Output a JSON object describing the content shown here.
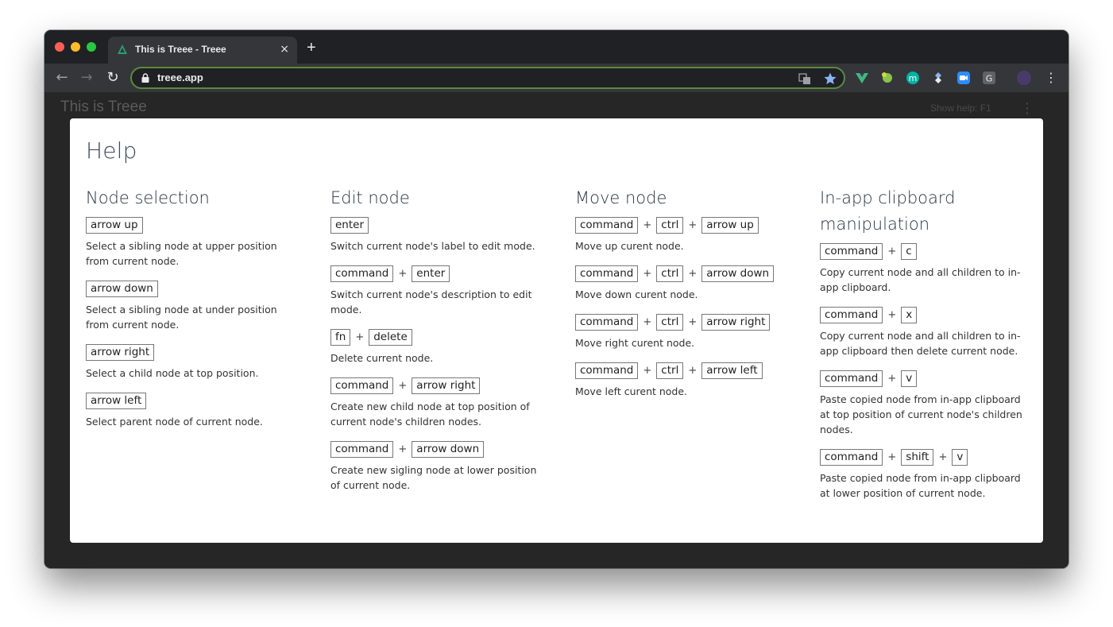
{
  "browser": {
    "tab_title": "This is Treee - Treee",
    "tab_close_icon": "×",
    "new_tab_icon": "+",
    "url": "treee.app",
    "accent": "#5b8a3c"
  },
  "app": {
    "title": "This is Treee",
    "help_hint": "Show help: F1",
    "menu_icon": "⋮"
  },
  "help": {
    "title": "Help",
    "columns": [
      {
        "heading": "Node selection",
        "entries": [
          {
            "keys": [
              "arrow up"
            ],
            "desc": "Select a sibling node at upper position from current node."
          },
          {
            "keys": [
              "arrow down"
            ],
            "desc": "Select a sibling node at under position from current node."
          },
          {
            "keys": [
              "arrow right"
            ],
            "desc": "Select a child node at top position."
          },
          {
            "keys": [
              "arrow left"
            ],
            "desc": "Select parent node of current node."
          }
        ]
      },
      {
        "heading": "Edit node",
        "entries": [
          {
            "keys": [
              "enter"
            ],
            "desc": "Switch current node's label to edit mode."
          },
          {
            "keys": [
              "command",
              "enter"
            ],
            "desc": "Switch current node's description to edit mode."
          },
          {
            "keys": [
              "fn",
              "delete"
            ],
            "desc": "Delete current node."
          },
          {
            "keys": [
              "command",
              "arrow right"
            ],
            "desc": "Create new child node at top position of current node's children nodes."
          },
          {
            "keys": [
              "command",
              "arrow down"
            ],
            "desc": "Create new sigling node at lower position of current node."
          }
        ]
      },
      {
        "heading": "Move node",
        "entries": [
          {
            "keys": [
              "command",
              "ctrl",
              "arrow up"
            ],
            "desc": "Move up curent node."
          },
          {
            "keys": [
              "command",
              "ctrl",
              "arrow down"
            ],
            "desc": "Move down curent node."
          },
          {
            "keys": [
              "command",
              "ctrl",
              "arrow right"
            ],
            "desc": "Move right curent node."
          },
          {
            "keys": [
              "command",
              "ctrl",
              "arrow left"
            ],
            "desc": "Move left curent node."
          }
        ]
      },
      {
        "heading": "In-app clipboard manipulation",
        "entries": [
          {
            "keys": [
              "command",
              "c"
            ],
            "desc": "Copy current node and all children to in-app clipboard."
          },
          {
            "keys": [
              "command",
              "x"
            ],
            "desc": "Copy current node and all children to in-app clipboard then delete current node."
          },
          {
            "keys": [
              "command",
              "v"
            ],
            "desc": "Paste copied node from in-app clipboard at top position of current node's children nodes."
          },
          {
            "keys": [
              "command",
              "shift",
              "v"
            ],
            "desc": "Paste copied node from in-app clipboard at lower position of current node."
          }
        ]
      }
    ],
    "plus_sign": "+"
  }
}
